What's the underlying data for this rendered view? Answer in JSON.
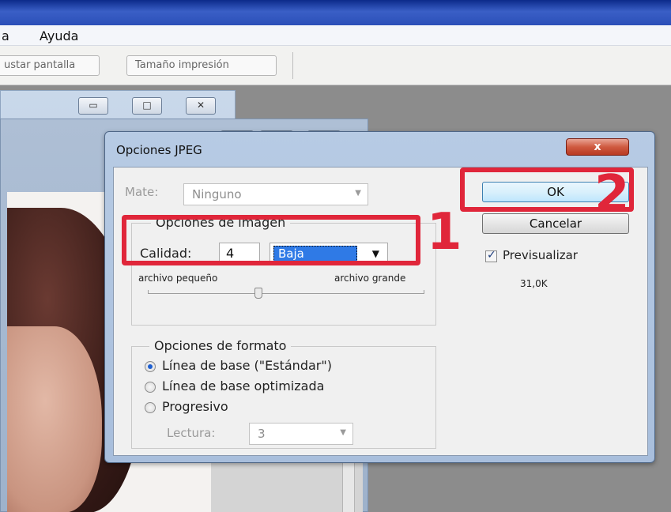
{
  "menubar": {
    "items": [
      "a",
      "Ayuda"
    ]
  },
  "toolbar": {
    "fit_screen": "ustar pantalla",
    "print_size": "Tamaño impresión"
  },
  "doc_window": {
    "minimize_glyph": "▭",
    "maximize_glyph": "□",
    "close_glyph": "✕"
  },
  "dialog": {
    "title": "Opciones JPEG",
    "close_label": "x",
    "matte_label": "Mate:",
    "matte_value": "Ninguno",
    "image_options": {
      "title": "Opciones de imagen",
      "quality_label": "Calidad:",
      "quality_value": "4",
      "quality_preset": "Baja",
      "small_file": "archivo pequeño",
      "large_file": "archivo grande",
      "slider_level": 0.4
    },
    "format_options": {
      "title": "Opciones de formato",
      "options": [
        "Línea de base (\"Estándar\")",
        "Línea de base optimizada",
        "Progresivo"
      ],
      "selected_index": 0,
      "scans_label": "Lectura:",
      "scans_value": "3"
    },
    "ok_label": "OK",
    "cancel_label": "Cancelar",
    "preview_label": "Previsualizar",
    "preview_checked": true,
    "file_size": "31,0K"
  },
  "annotations": [
    "1",
    "2"
  ],
  "colors": {
    "annotation": "#e0263a",
    "highlight": "#2f7ae6"
  }
}
